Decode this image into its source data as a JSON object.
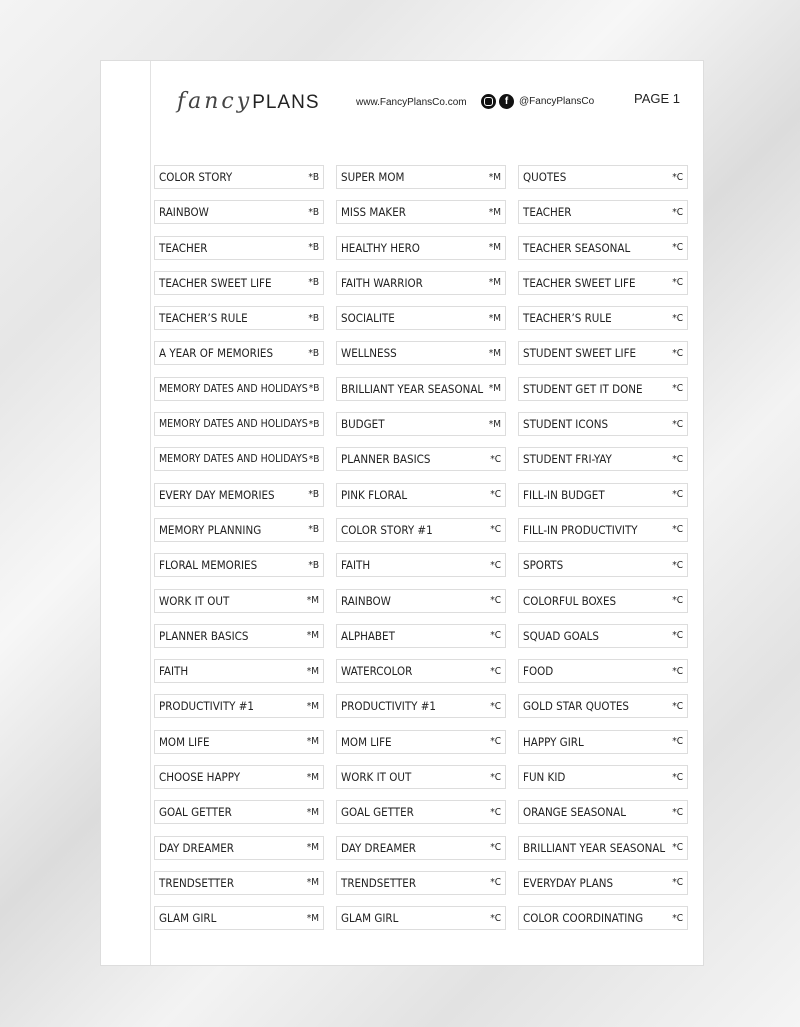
{
  "header": {
    "logo_script": "fancy",
    "logo_plans": "PLANS",
    "website": "www.FancyPlansCo.com",
    "social_handle": "@FancyPlansCo",
    "page_label": "PAGE 1",
    "icons": [
      "instagram-icon",
      "facebook-icon"
    ]
  },
  "columns": [
    [
      [
        "COLOR STORY",
        "*B"
      ],
      [
        "RAINBOW",
        "*B"
      ],
      [
        "TEACHER",
        "*B"
      ],
      [
        "TEACHER SWEET LIFE",
        "*B"
      ],
      [
        "TEACHER’S RULE",
        "*B"
      ],
      [
        "A YEAR OF MEMORIES",
        "*B"
      ],
      [
        "MEMORY DATES AND HOLIDAYS",
        "*B"
      ],
      [
        "MEMORY DATES AND HOLIDAYS",
        "*B"
      ],
      [
        "MEMORY DATES AND HOLIDAYS",
        "*B"
      ],
      [
        "EVERY DAY MEMORIES",
        "*B"
      ],
      [
        "MEMORY PLANNING",
        "*B"
      ],
      [
        "FLORAL MEMORIES",
        "*B"
      ],
      [
        "WORK IT OUT",
        "*M"
      ],
      [
        "PLANNER BASICS",
        "*M"
      ],
      [
        "FAITH",
        "*M"
      ],
      [
        "PRODUCTIVITY #1",
        "*M"
      ],
      [
        "MOM LIFE",
        "*M"
      ],
      [
        "CHOOSE HAPPY",
        "*M"
      ],
      [
        "GOAL GETTER",
        "*M"
      ],
      [
        "DAY DREAMER",
        "*M"
      ],
      [
        "TRENDSETTER",
        "*M"
      ],
      [
        "GLAM GIRL",
        "*M"
      ]
    ],
    [
      [
        "SUPER MOM",
        "*M"
      ],
      [
        "MISS MAKER",
        "*M"
      ],
      [
        "HEALTHY HERO",
        "*M"
      ],
      [
        "FAITH WARRIOR",
        "*M"
      ],
      [
        "SOCIALITE",
        "*M"
      ],
      [
        "WELLNESS",
        "*M"
      ],
      [
        "BRILLIANT YEAR SEASONAL",
        "*M"
      ],
      [
        "BUDGET",
        "*M"
      ],
      [
        "PLANNER BASICS",
        "*C"
      ],
      [
        "PINK FLORAL",
        "*C"
      ],
      [
        "COLOR STORY #1",
        "*C"
      ],
      [
        "FAITH",
        "*C"
      ],
      [
        "RAINBOW",
        "*C"
      ],
      [
        "ALPHABET",
        "*C"
      ],
      [
        "WATERCOLOR",
        "*C"
      ],
      [
        "PRODUCTIVITY #1",
        "*C"
      ],
      [
        "MOM LIFE",
        "*C"
      ],
      [
        "WORK IT OUT",
        "*C"
      ],
      [
        "GOAL GETTER",
        "*C"
      ],
      [
        "DAY DREAMER",
        "*C"
      ],
      [
        "TRENDSETTER",
        "*C"
      ],
      [
        "GLAM GIRL",
        "*C"
      ]
    ],
    [
      [
        "QUOTES",
        "*C"
      ],
      [
        "TEACHER",
        "*C"
      ],
      [
        "TEACHER SEASONAL",
        "*C"
      ],
      [
        "TEACHER SWEET LIFE",
        "*C"
      ],
      [
        "TEACHER’S RULE",
        "*C"
      ],
      [
        "STUDENT SWEET LIFE",
        "*C"
      ],
      [
        "STUDENT GET IT DONE",
        "*C"
      ],
      [
        "STUDENT ICONS",
        "*C"
      ],
      [
        "STUDENT FRI-YAY",
        "*C"
      ],
      [
        "FILL-IN BUDGET",
        "*C"
      ],
      [
        "FILL-IN PRODUCTIVITY",
        "*C"
      ],
      [
        "SPORTS",
        "*C"
      ],
      [
        "COLORFUL BOXES",
        "*C"
      ],
      [
        "SQUAD GOALS",
        "*C"
      ],
      [
        "FOOD",
        "*C"
      ],
      [
        "GOLD STAR QUOTES",
        "*C"
      ],
      [
        "HAPPY GIRL",
        "*C"
      ],
      [
        "FUN KID",
        "*C"
      ],
      [
        "ORANGE SEASONAL",
        "*C"
      ],
      [
        "BRILLIANT YEAR SEASONAL",
        "*C"
      ],
      [
        "EVERYDAY PLANS",
        "*C"
      ],
      [
        "COLOR COORDINATING",
        "*C"
      ]
    ]
  ]
}
